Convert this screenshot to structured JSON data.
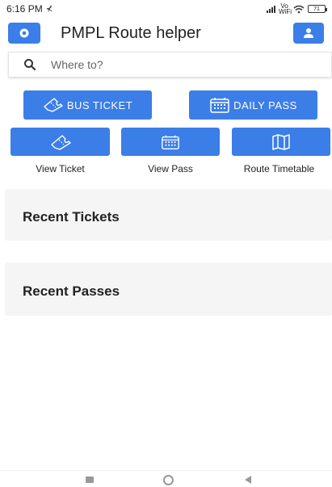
{
  "status_bar": {
    "time": "6:16 PM",
    "battery": "71",
    "network_label": "Vo WiFi"
  },
  "app_bar": {
    "title": "PMPL Route helper"
  },
  "search": {
    "placeholder": "Where to?",
    "value": ""
  },
  "actions": {
    "bus_ticket_label": "BUS TICKET",
    "daily_pass_label": "DAILY PASS"
  },
  "quick_links": [
    {
      "label": "View Ticket",
      "icon": "ticket-icon"
    },
    {
      "label": "View Pass",
      "icon": "calendar-icon"
    },
    {
      "label": "Route Timetable",
      "icon": "map-icon"
    }
  ],
  "sections": {
    "recent_tickets_title": "Recent Tickets",
    "recent_passes_title": "Recent Passes"
  },
  "colors": {
    "accent": "#3b7ee8",
    "card_bg": "#f5f5f5"
  }
}
